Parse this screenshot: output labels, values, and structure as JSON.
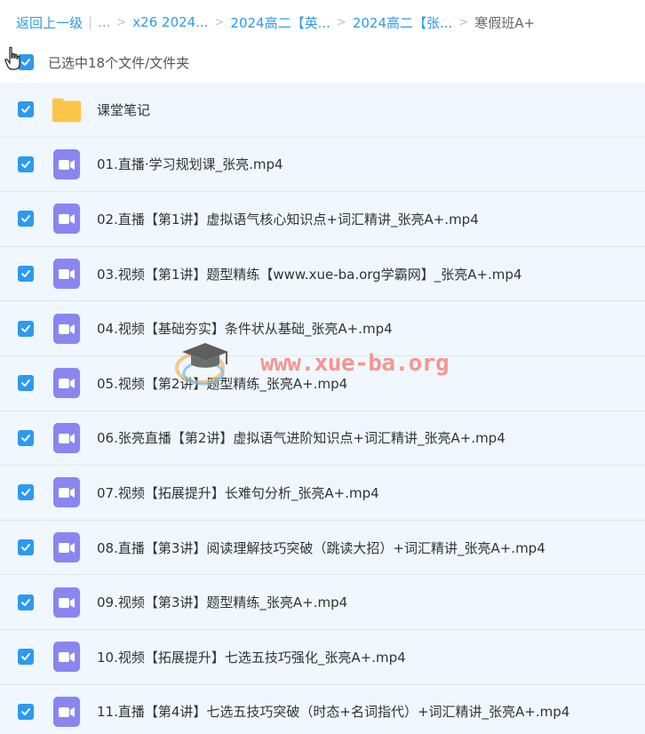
{
  "breadcrumb": {
    "back_label": "返回上一级",
    "ellipsis": "...",
    "items": [
      "x26 2024...",
      "2024高二【英...",
      "2024高二【张..."
    ],
    "current": "寒假班A+"
  },
  "selection": {
    "count_text": "已选中18个文件/文件夹"
  },
  "files": [
    {
      "name": "课堂笔记",
      "type": "folder"
    },
    {
      "name": "01.直播·学习规划课_张亮.mp4",
      "type": "video"
    },
    {
      "name": "02.直播【第1讲】虚拟语气核心知识点+词汇精讲_张亮A+.mp4",
      "type": "video"
    },
    {
      "name": "03.视频【第1讲】题型精练【www.xue-ba.org学霸网】_张亮A+.mp4",
      "type": "video"
    },
    {
      "name": "04.视频【基础夯实】条件状从基础_张亮A+.mp4",
      "type": "video"
    },
    {
      "name": "05.视频【第2讲】题型精练_张亮A+.mp4",
      "type": "video"
    },
    {
      "name": "06.张亮直播【第2讲】虚拟语气进阶知识点+词汇精讲_张亮A+.mp4",
      "type": "video"
    },
    {
      "name": "07.视频【拓展提升】长难句分析_张亮A+.mp4",
      "type": "video"
    },
    {
      "name": "08.直播【第3讲】阅读理解技巧突破（跳读大招）+词汇精讲_张亮A+.mp4",
      "type": "video"
    },
    {
      "name": "09.视频【第3讲】题型精练_张亮A+.mp4",
      "type": "video"
    },
    {
      "name": "10.视频【拓展提升】七选五技巧强化_张亮A+.mp4",
      "type": "video"
    },
    {
      "name": "11.直播【第4讲】七选五技巧突破（时态+名词指代）+词汇精讲_张亮A+.mp4",
      "type": "video"
    }
  ],
  "watermark": {
    "text": "www.xue-ba.org"
  },
  "colors": {
    "accent": "#2c9af0",
    "video_icon": "#8a86f0",
    "folder_icon": "#fcc54a",
    "row_bg": "#f0f7fe"
  }
}
